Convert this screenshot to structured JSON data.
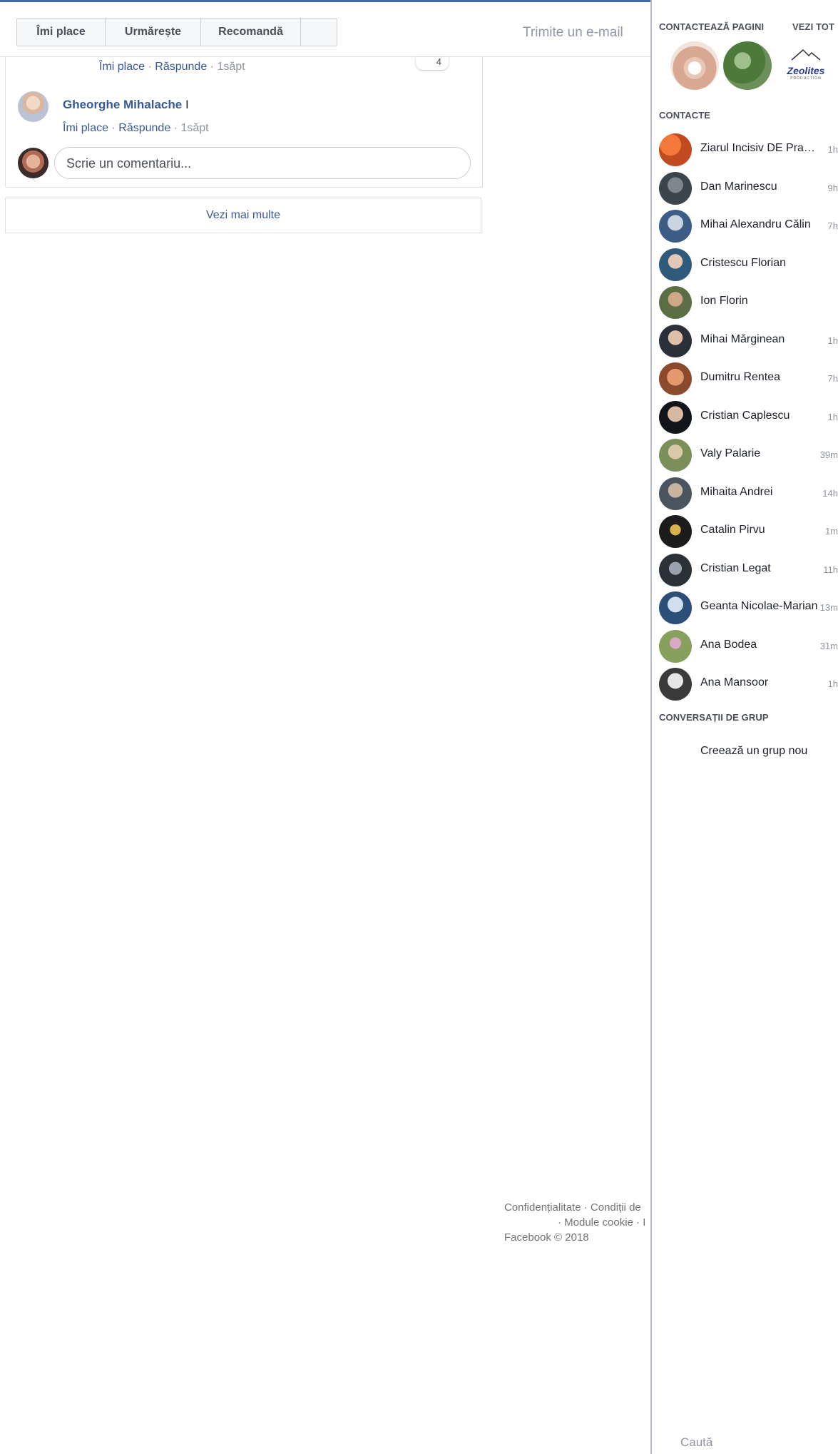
{
  "toolbar": {
    "like_label": "Îmi place",
    "follow_label": "Urmărește",
    "recommend_label": "Recomandă",
    "email_label": "Trimite un e-mail"
  },
  "comments": {
    "reply_row_1": {
      "like": "Îmi place",
      "reply": "Răspunde",
      "time": "1săpt"
    },
    "reply_count": "4",
    "author": "Gheorghe Mihalache",
    "author_tail": "I",
    "reply_row_2": {
      "like": "Îmi place",
      "reply": "Răspunde",
      "time": "1săpt"
    },
    "input_placeholder": "Scrie un comentariu...",
    "separator": "·"
  },
  "more_label": "Vezi mai multe",
  "footer": {
    "line1": "Confidențialitate · Condiții de",
    "line2": "· Module cookie · I",
    "line3": "Facebook © 2018"
  },
  "sidebar": {
    "pages_header": "CONTACTEAZĂ PAGINI",
    "see_all": "VEZI TOT",
    "page_logo_text": "Zeolites",
    "page_logo_sub": "PRODUCTION",
    "contacts_header": "CONTACTE",
    "contacts": [
      {
        "name": "Ziarul Incisiv DE Prahova",
        "time": "1h"
      },
      {
        "name": "Dan Marinescu",
        "time": "9h"
      },
      {
        "name": "Mihai Alexandru Călin",
        "time": "7h"
      },
      {
        "name": "Cristescu Florian",
        "time": ""
      },
      {
        "name": "Ion Florin",
        "time": ""
      },
      {
        "name": "Mihai Mărginean",
        "time": "1h"
      },
      {
        "name": "Dumitru Rentea",
        "time": "7h"
      },
      {
        "name": "Cristian Caplescu",
        "time": "1h"
      },
      {
        "name": "Valy Palarie",
        "time": "39m"
      },
      {
        "name": "Mihaita Andrei",
        "time": "14h"
      },
      {
        "name": "Catalin Pirvu",
        "time": "1m"
      },
      {
        "name": "Cristian Legat",
        "time": "11h"
      },
      {
        "name": "Geanta Nicolae-Marian",
        "time": "13m"
      },
      {
        "name": "Ana Bodea",
        "time": "31m"
      },
      {
        "name": "Ana Mansoor",
        "time": "1h"
      }
    ],
    "groups_header": "CONVERSAȚII DE GRUP",
    "new_group": "Creează un grup nou",
    "search_placeholder": "Caută"
  }
}
